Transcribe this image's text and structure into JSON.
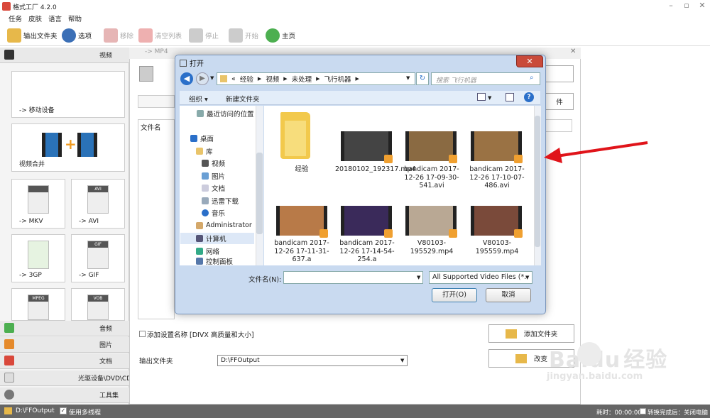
{
  "window": {
    "title": "格式工厂 4.2.0"
  },
  "menu": [
    "任务",
    "皮肤",
    "语言",
    "帮助"
  ],
  "toolbar": {
    "output_folder": "输出文件夹",
    "options": "选项",
    "remove": "移除",
    "clear_list": "清空列表",
    "stop": "停止",
    "start": "开始",
    "home": "主页"
  },
  "left": {
    "video": "视频",
    "mobile": "-> 移动设备",
    "merge": "视频合并",
    "mkv": "-> MKV",
    "avi": "-> AVI",
    "gp3": "-> 3GP",
    "gif": "-> GIF",
    "icon_avi": "AVI",
    "icon_gif": "GIF",
    "icon_mpeg": "MPEG",
    "icon_vob": "VOB",
    "audio": "音频",
    "picture": "图片",
    "document": "文档",
    "disc": "光驱设备\\DVD\\CD\\ISO",
    "tools": "工具集"
  },
  "panel": {
    "title": "-> MP4",
    "filename_header": "文件名",
    "settings_cb": "添加设置名称 [DIVX 高质量和大小]",
    "output_label": "输出文件夹",
    "output_value": "D:\\FFOutput",
    "add_file": "添加文件夹",
    "change": "改变",
    "partial_btn": "件"
  },
  "dialog": {
    "title": "打开",
    "path": [
      "«",
      "经验",
      "视频",
      "未处理",
      "飞行机器"
    ],
    "search_placeholder": "搜索 飞行机器",
    "organize": "组织 ▾",
    "new_folder": "新建文件夹",
    "nav": [
      "最近访问的位置",
      "桌面",
      "库",
      "视频",
      "图片",
      "文档",
      "迅雷下载",
      "音乐",
      "Administrator",
      "计算机",
      "网络",
      "控制面板"
    ],
    "files": [
      "经验",
      "20180102_192317.mp4",
      "bandicam 2017-12-26 17-09-30-541.avi",
      "bandicam 2017-12-26 17-10-07-486.avi",
      "bandicam 2017-12-26 17-11-31-637.a",
      "bandicam 2017-12-26 17-14-54-254.a",
      "V80103-195529.mp4",
      "V80103-195559.mp4"
    ],
    "filename_label": "文件名(N):",
    "filetype": "All Supported Video Files (*.",
    "open": "打开(O)",
    "cancel": "取消"
  },
  "status": {
    "path": "D:\\FFOutput",
    "multithread": "使用多线程",
    "elapsed": "耗时：00:00:00",
    "after": "转换完成后：关闭电脑"
  },
  "watermark": {
    "brand": "Baidu",
    "brand_cn": "经验",
    "url": "jingyan.baidu.com"
  },
  "colors": {
    "accent": "#2a6fc9",
    "arrow": "#e0141a",
    "folder": "#f2c94c",
    "dialog_frame": "#c9daf0"
  }
}
